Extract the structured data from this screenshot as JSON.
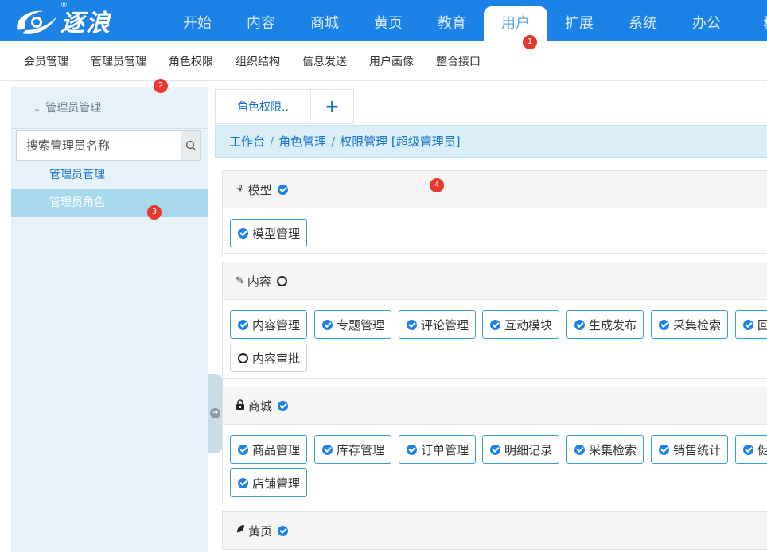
{
  "logo": {
    "text": "逐浪",
    "reg": "®"
  },
  "top_nav": [
    "开始",
    "内容",
    "商城",
    "黄页",
    "教育",
    "用户",
    "扩展",
    "系统",
    "办公",
    "移"
  ],
  "sub_nav": [
    "会员管理",
    "管理员管理",
    "角色权限",
    "组织结构",
    "信息发送",
    "用户画像",
    "整合接口"
  ],
  "badges": [
    "1",
    "2",
    "3",
    "4"
  ],
  "sidebar": {
    "header": "管理员管理",
    "search_placeholder": "搜索管理员名称",
    "links": [
      "管理员管理",
      "管理员角色"
    ]
  },
  "tabs": {
    "first": "角色权限..",
    "add": "+"
  },
  "breadcrumb": [
    "工作台",
    "角色管理",
    "权限管理 [超级管理员]"
  ],
  "sections": [
    {
      "icon": "sitemap-icon",
      "title": "模型",
      "checked": true,
      "items": [
        "模型管理"
      ]
    },
    {
      "icon": "pencil-icon",
      "title": "内容",
      "checked": false,
      "items": [
        "内容管理",
        "专题管理",
        "评论管理",
        "互动模块",
        "生成发布",
        "采集检索",
        "回",
        "内容审批"
      ]
    },
    {
      "icon": "lock-icon",
      "title": "商城",
      "checked": true,
      "items": [
        "商品管理",
        "库存管理",
        "订单管理",
        "明细记录",
        "采集检索",
        "销售统计",
        "促",
        "店铺管理"
      ]
    },
    {
      "icon": "leaf-icon",
      "title": "黄页",
      "checked": true,
      "items": []
    }
  ],
  "colors": {
    "topbar": "#1c82e6",
    "accent": "#1a74c7",
    "badge": "#e8392f",
    "sidebar_bg": "#e7f1f8",
    "active_link_bg": "#a8d9ea"
  }
}
